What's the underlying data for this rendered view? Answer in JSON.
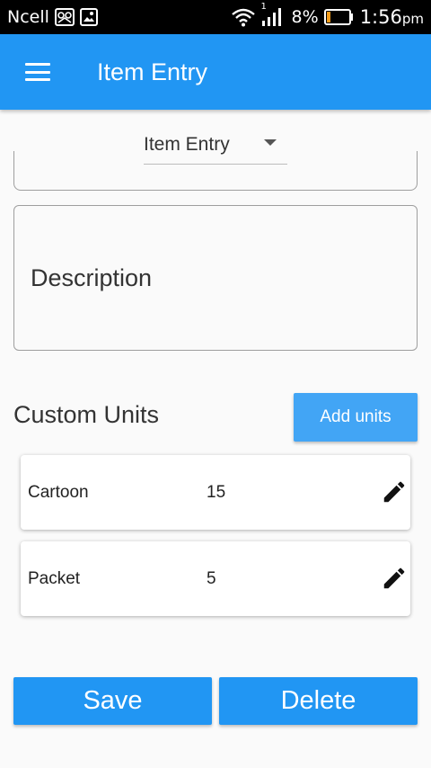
{
  "status_bar": {
    "carrier": "Ncell",
    "signal_sup": "1",
    "battery": "8%",
    "time": "1:56",
    "time_suffix": "pm"
  },
  "app_bar": {
    "title": "Item Entry"
  },
  "dropdown": {
    "selected": "Item Entry"
  },
  "description": {
    "label": "Description"
  },
  "custom_units": {
    "title": "Custom Units",
    "add_label": "Add units",
    "items": [
      {
        "name": "Cartoon",
        "qty": "15"
      },
      {
        "name": "Packet",
        "qty": "5"
      }
    ]
  },
  "actions": {
    "save_label": "Save",
    "delete_label": "Delete"
  },
  "colors": {
    "primary": "#2196f3",
    "add_button": "#42a5f5"
  }
}
